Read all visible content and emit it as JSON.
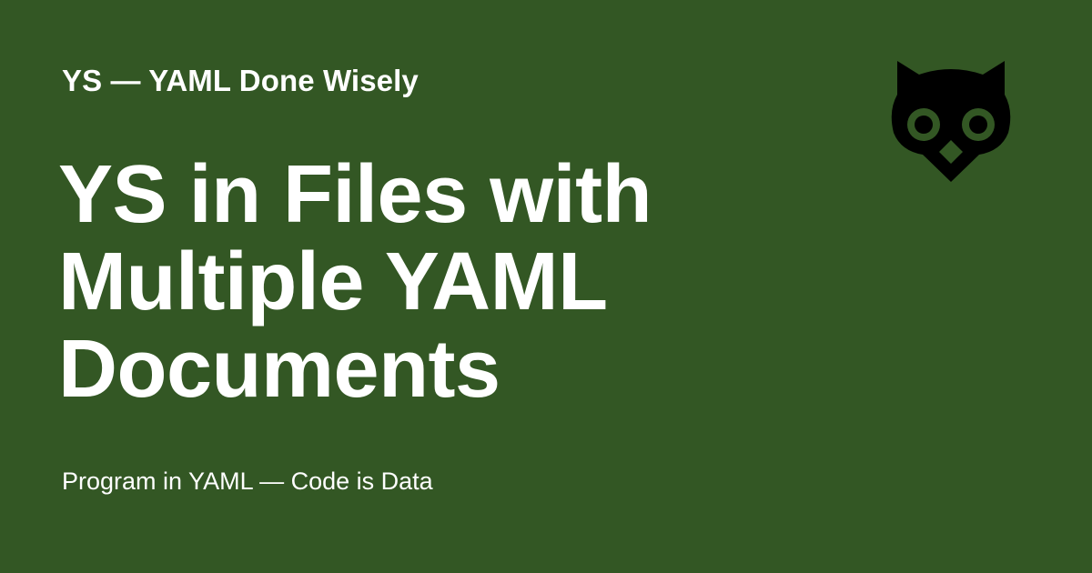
{
  "site": {
    "name": "YS — YAML Done Wisely"
  },
  "page": {
    "title_lines": [
      "YS in Files with",
      "Multiple YAML",
      "Documents"
    ],
    "tagline": "Program in YAML — Code is Data"
  },
  "logo": {
    "icon": "owl-icon"
  },
  "colors": {
    "background": "#335724",
    "text": "#ffffff",
    "logo": "#000000"
  }
}
